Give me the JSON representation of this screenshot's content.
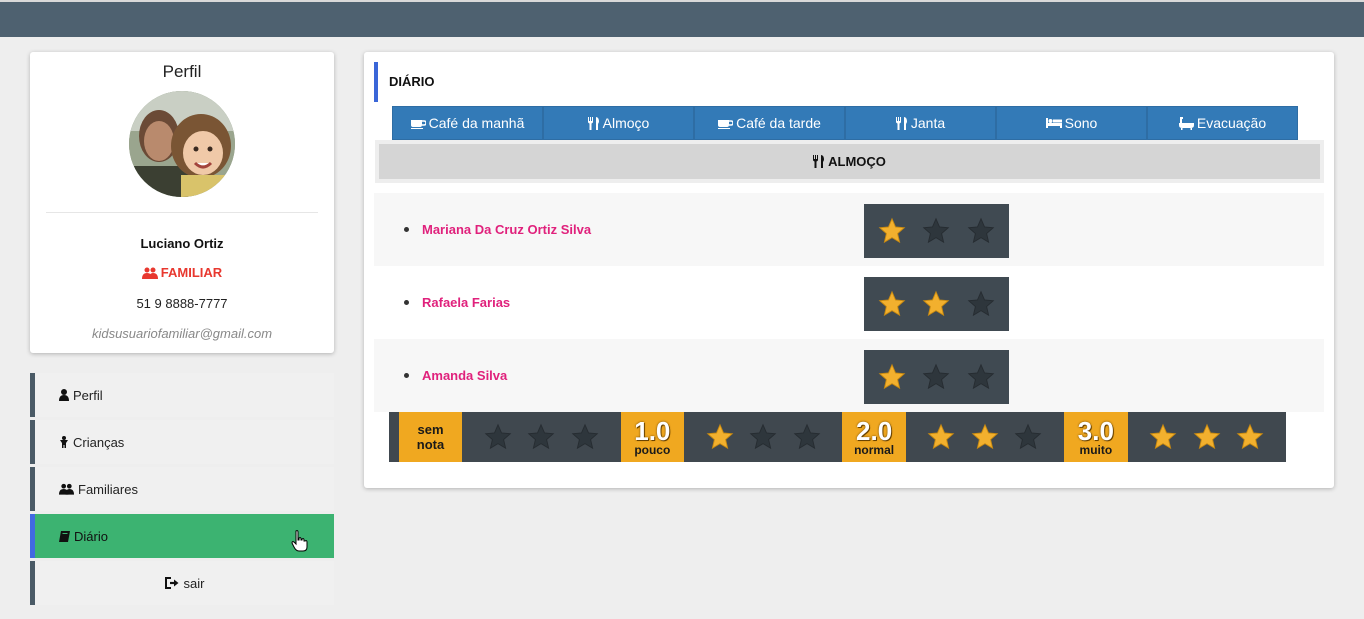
{
  "colors": {
    "topbar": "#4e6170",
    "accent_blue": "#337ab7",
    "active_green": "#3cb371",
    "role_red": "#e8382f",
    "name_pink": "#e0217c",
    "star_gold": "#f2b02e",
    "star_dark": "#2e363c"
  },
  "profile": {
    "title": "Perfil",
    "name": "Luciano Ortiz",
    "role": "FAMILIAR",
    "role_icon": "users-icon",
    "phone": "51 9 8888-7777",
    "email": "kidsusuariofamiliar@gmail.com"
  },
  "menu": {
    "items": [
      {
        "label": "Perfil",
        "icon": "user-icon"
      },
      {
        "label": "Crianças",
        "icon": "child-icon"
      },
      {
        "label": "Familiares",
        "icon": "users-icon"
      },
      {
        "label": "Diário",
        "icon": "book-icon",
        "active": true
      },
      {
        "label": "sair",
        "icon": "sign-out-icon"
      }
    ]
  },
  "diary": {
    "title": "DIÁRIO",
    "tabs": [
      {
        "label": "Café da manhã",
        "icon": "coffee-icon"
      },
      {
        "label": "Almoço",
        "icon": "cutlery-icon"
      },
      {
        "label": "Café da tarde",
        "icon": "coffee-icon"
      },
      {
        "label": "Janta",
        "icon": "cutlery-icon"
      },
      {
        "label": "Sono",
        "icon": "bed-icon"
      },
      {
        "label": "Evacuação",
        "icon": "bath-icon"
      }
    ],
    "section_title": "ALMOÇO",
    "section_icon": "cutlery-icon",
    "entries": [
      {
        "name": "Mariana Da Cruz Ortiz Silva",
        "stars": 1
      },
      {
        "name": "Rafaela Farias",
        "stars": 2
      },
      {
        "name": "Amanda Silva",
        "stars": 1
      }
    ],
    "legend": [
      {
        "line1": "sem",
        "line2": "nota",
        "stars": 0
      },
      {
        "value": "1.0",
        "label": "pouco",
        "stars": 1
      },
      {
        "value": "2.0",
        "label": "normal",
        "stars": 2
      },
      {
        "value": "3.0",
        "label": "muito",
        "stars": 3
      }
    ]
  }
}
